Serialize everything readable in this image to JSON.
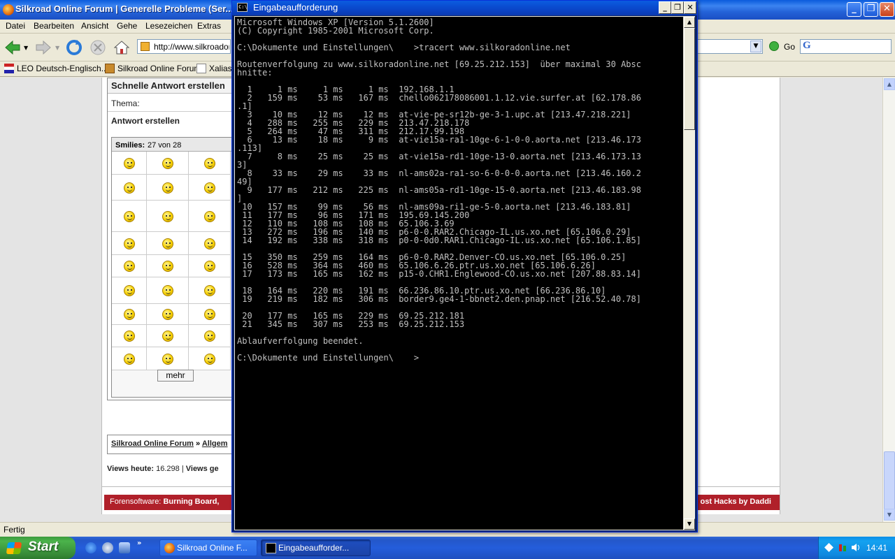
{
  "firefox": {
    "title": "Silkroad Online Forum | Generelle Probleme (Ser...",
    "menu": [
      "Datei",
      "Bearbeiten",
      "Ansicht",
      "Gehe",
      "Lesezeichen",
      "Extras"
    ],
    "url": "http://www.silkroadonl",
    "go_label": "Go",
    "search_logo": "G",
    "bookmarks": [
      "LEO Deutsch-Englisch...",
      "Silkroad Online Forum",
      "Xalias"
    ],
    "status": "Fertig"
  },
  "forum": {
    "reply_header": "Schnelle Antwort erstellen",
    "thema_label": "Thema:",
    "reply_label": "Antwort erstellen",
    "smilies_label": "Smilies:",
    "smilies_count": "27 von 28",
    "smilie_faces": [
      "smile",
      "wink",
      "thinking",
      "whistle",
      "cheer",
      "sick",
      "roll-eyes",
      "confused",
      "applause",
      "angry",
      "dead",
      "cool",
      "blush",
      "surprised",
      "sad",
      "rolleyes",
      "doubt",
      "nerd",
      "unhappy",
      "eek",
      "neutral",
      "crying",
      "laugh",
      "wacko",
      "question",
      "clap",
      "tongue"
    ],
    "mehr_label": "mehr",
    "breadcrumb_home": "Silkroad Online Forum",
    "breadcrumb_sep": "»",
    "breadcrumb_next": "Allgem",
    "views_label": "Views heute:",
    "views_value": "16.298",
    "views_sep": "|",
    "views_label2": "Views ge",
    "footer_prefix": "Forensoftware:",
    "footer_brand": "Burning Board,",
    "footer_right": "ost Hacks by Daddi"
  },
  "cmd": {
    "title": "Eingabeaufforderung",
    "icon_text": "C:\\",
    "lines": [
      "Microsoft Windows XP [Version 5.1.2600]",
      "(C) Copyright 1985-2001 Microsoft Corp.",
      "",
      "C:\\Dokumente und Einstellungen\\    >tracert www.silkoradonline.net",
      "",
      "Routenverfolgung zu www.silkoradonline.net [69.25.212.153]  über maximal 30 Absc",
      "hnitte:",
      "",
      "  1     1 ms     1 ms     1 ms  192.168.1.1",
      "  2   159 ms    53 ms   167 ms  chello062178086001.1.12.vie.surfer.at [62.178.86",
      ".1]",
      "  3    10 ms    12 ms    12 ms  at-vie-pe-sr12b-ge-3-1.upc.at [213.47.218.221]",
      "  4   288 ms   255 ms   229 ms  213.47.218.178",
      "  5   264 ms    47 ms   311 ms  212.17.99.198",
      "  6    13 ms    18 ms     9 ms  at-vie15a-ra1-10ge-6-1-0-0.aorta.net [213.46.173",
      ".113]",
      "  7     8 ms    25 ms    25 ms  at-vie15a-rd1-10ge-13-0.aorta.net [213.46.173.13",
      "3]",
      "  8    33 ms    29 ms    33 ms  nl-ams02a-ra1-so-6-0-0-0.aorta.net [213.46.160.2",
      "49]",
      "  9   177 ms   212 ms   225 ms  nl-ams05a-rd1-10ge-15-0.aorta.net [213.46.183.98",
      "]",
      " 10   157 ms    99 ms    56 ms  nl-ams09a-ri1-ge-5-0.aorta.net [213.46.183.81]",
      " 11   177 ms    96 ms   171 ms  195.69.145.200",
      " 12   110 ms   108 ms   108 ms  65.106.3.69",
      " 13   272 ms   196 ms   140 ms  p6-0-0.RAR2.Chicago-IL.us.xo.net [65.106.0.29]",
      " 14   192 ms   338 ms   318 ms  p0-0-0d0.RAR1.Chicago-IL.us.xo.net [65.106.1.85]",
      "",
      " 15   350 ms   259 ms   164 ms  p6-0-0.RAR2.Denver-CO.us.xo.net [65.106.0.25]",
      " 16   528 ms   364 ms   460 ms  65.106.6.26.ptr.us.xo.net [65.106.6.26]",
      " 17   173 ms   165 ms   162 ms  p15-0.CHR1.Englewood-CO.us.xo.net [207.88.83.14]",
      "",
      " 18   164 ms   220 ms   191 ms  66.236.86.10.ptr.us.xo.net [66.236.86.10]",
      " 19   219 ms   182 ms   306 ms  border9.ge4-1-bbnet2.den.pnap.net [216.52.40.78]",
      "",
      " 20   177 ms   165 ms   229 ms  69.25.212.181",
      " 21   345 ms   307 ms   253 ms  69.25.212.153",
      "",
      "Ablaufverfolgung beendet.",
      "",
      "C:\\Dokumente und Einstellungen\\    >"
    ]
  },
  "taskbar": {
    "start_label": "Start",
    "quicklaunch_more": "»",
    "tasks": [
      "Silkroad Online F...",
      "Eingabeaufforder..."
    ],
    "clock": "14:41"
  },
  "colors": {
    "xp_blue": "#245ddb",
    "start_green": "#3c9a3c",
    "forum_footer_red": "#b0202a",
    "console_text": "#c0c0c0"
  }
}
